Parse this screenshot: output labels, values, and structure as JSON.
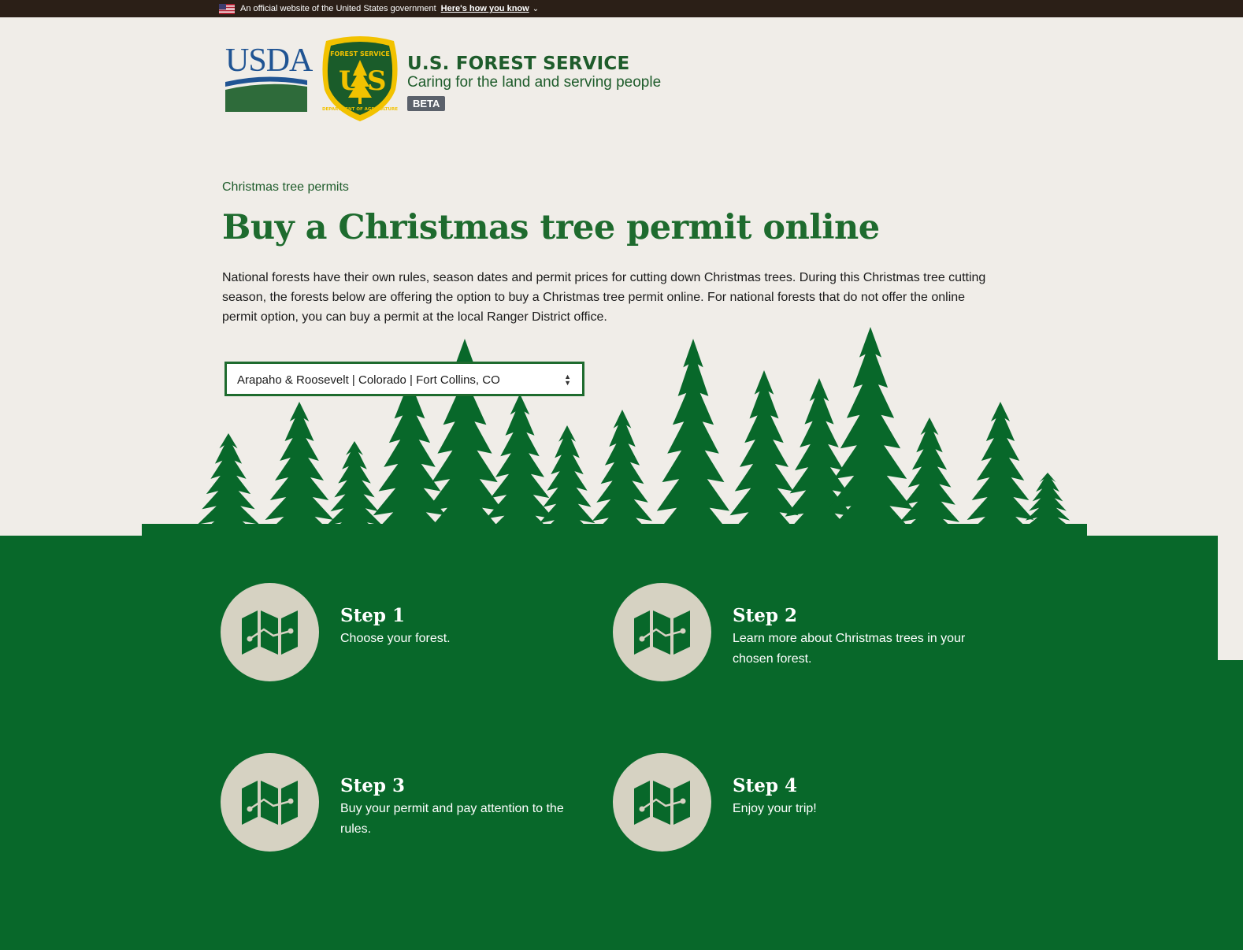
{
  "gov_banner": {
    "text": "An official website of the United States government",
    "link": "Here's how you know"
  },
  "header": {
    "usda_logo_text": "USDA",
    "agency": "U.S. FOREST SERVICE",
    "tagline": "Caring for the land and serving people",
    "badge": "BETA",
    "shield_top_text": "FOREST SERVICE",
    "shield_bottom_text": "DEPARTMENT OF AGRICULTURE"
  },
  "breadcrumb": "Christmas tree permits",
  "title": "Buy a Christmas tree permit online",
  "intro": "National forests have their own rules, season dates and permit prices for cutting down Christmas trees. During this Christmas tree cutting season, the forests below are offering the option to buy a Christmas tree permit online. For national forests that do not offer the online permit option, you can buy a permit at the local Ranger District office.",
  "forest_select": {
    "selected": "Arapaho & Roosevelt | Colorado | Fort Collins, CO"
  },
  "steps": [
    {
      "title": "Step 1",
      "desc": "Choose your forest.",
      "icon": "map-icon"
    },
    {
      "title": "Step 2",
      "desc": "Learn more about Christmas trees in your chosen forest.",
      "icon": "map-icon"
    },
    {
      "title": "Step 3",
      "desc": "Buy your permit and pay attention to the rules.",
      "icon": "map-icon"
    },
    {
      "title": "Step 4",
      "desc": "Enjoy your trip!",
      "icon": "map-icon"
    }
  ],
  "colors": {
    "forest_green": "#08682a",
    "title_green": "#1e6b2e",
    "background": "#f0ede8",
    "circle": "#d6d2c2",
    "shield_gold": "#f2c200",
    "usda_blue": "#205493"
  }
}
